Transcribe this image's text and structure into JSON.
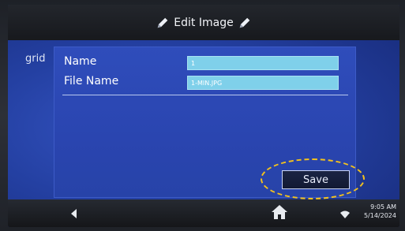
{
  "header": {
    "title": "Edit Image"
  },
  "panel": {
    "side_label": "grid",
    "rows": [
      {
        "label": "Name",
        "value": "1"
      },
      {
        "label": "File Name",
        "value": "1-MIN.JPG"
      }
    ],
    "save_label": "Save"
  },
  "status": {
    "time": "9:05 AM",
    "date": "5/14/2024"
  },
  "icons": {
    "title_left": "pencil-icon",
    "title_right": "pencil-icon",
    "back": "back-arrow-icon",
    "home": "home-icon",
    "wifi": "wifi-icon"
  },
  "colors": {
    "screen_bg": "#2440a2",
    "field_bg": "#7fd0ea",
    "save_bg": "#121a33",
    "highlight": "#f3c21d"
  }
}
